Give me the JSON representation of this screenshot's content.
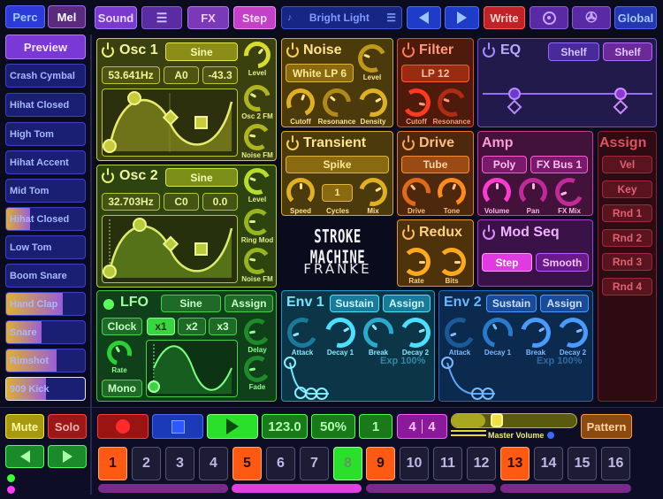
{
  "top": {
    "perc": "Perc",
    "mel": "Mel",
    "sound": "Sound",
    "fx": "FX",
    "step": "Step",
    "preset": "Bright Light",
    "write": "Write",
    "global": "Global"
  },
  "sidebar": {
    "preview": "Preview",
    "items": [
      {
        "label": "Crash Cymbal",
        "level": 0
      },
      {
        "label": "Hihat Closed",
        "level": 0
      },
      {
        "label": "High Tom",
        "level": 0
      },
      {
        "label": "Hihat Accent",
        "level": 0
      },
      {
        "label": "Mid Tom",
        "level": 0
      },
      {
        "label": "Hihat Closed",
        "level": 0.3
      },
      {
        "label": "Low Tom",
        "level": 0
      },
      {
        "label": "Boom Snare",
        "level": 0
      },
      {
        "label": "Hand Clap",
        "level": 0.72
      },
      {
        "label": "Snare",
        "level": 0.45
      },
      {
        "label": "Rimshot",
        "level": 0.64
      },
      {
        "label": "909 Kick",
        "level": 0.5
      }
    ]
  },
  "osc1": {
    "title": "Osc 1",
    "wave": "Sine",
    "freq": "53.641Hz",
    "note": "A0",
    "cents": "-43.3",
    "k1": "Level",
    "k2": "Osc 2 FM",
    "k3": "Noise FM"
  },
  "osc2": {
    "title": "Osc 2",
    "wave": "Sine",
    "freq": "32.703Hz",
    "note": "C0",
    "cents": "0.0",
    "k1": "Level",
    "k2": "Ring Mod",
    "k3": "Noise FM"
  },
  "lfo": {
    "title": "LFO",
    "wave": "Sine",
    "assign": "Assign",
    "clock": "Clock",
    "x1": "x1",
    "x2": "x2",
    "x3": "x3",
    "rate": "Rate",
    "mono": "Mono",
    "delay": "Delay",
    "fade": "Fade"
  },
  "noise": {
    "title": "Noise",
    "type": "White LP 6",
    "level": "Level",
    "cutoff": "Cutoff",
    "resonance": "Resonance",
    "density": "Density"
  },
  "transient": {
    "title": "Transient",
    "type": "Spike",
    "speed": "Speed",
    "cycles_value": "1",
    "cycles": "Cycles",
    "mix": "Mix"
  },
  "filter": {
    "title": "Filter",
    "type": "LP 12",
    "cutoff": "Cutoff",
    "resonance": "Resonance"
  },
  "drive": {
    "title": "Drive",
    "type": "Tube",
    "drive": "Drive",
    "tone": "Tone"
  },
  "redux": {
    "title": "Redux",
    "rate": "Rate",
    "bits": "Bits"
  },
  "eq": {
    "title": "EQ",
    "shelf1": "Shelf",
    "shelf2": "Shelf"
  },
  "amp": {
    "title": "Amp",
    "poly": "Poly",
    "bus": "FX Bus 1",
    "volume": "Volume",
    "pan": "Pan",
    "fxmix": "FX Mix"
  },
  "modseq": {
    "title": "Mod Seq",
    "step": "Step",
    "smooth": "Smooth"
  },
  "assign": {
    "title": "Assign",
    "items": [
      "Vel",
      "Key",
      "Rnd 1",
      "Rnd 2",
      "Rnd 3",
      "Rnd 4"
    ]
  },
  "logo": {
    "line1": "STROKE MACHINE",
    "line2": "FRANKE"
  },
  "env1": {
    "title": "Env 1",
    "sustain": "Sustain",
    "assign": "Assign",
    "attack": "Attack",
    "decay1": "Decay 1",
    "break": "Break",
    "decay2": "Decay 2",
    "exp": "Exp 100%"
  },
  "env2": {
    "title": "Env 2",
    "sustain": "Sustain",
    "assign": "Assign",
    "attack": "Attack",
    "decay1": "Decay 1",
    "break": "Break",
    "decay2": "Decay 2",
    "exp": "Exp 100%"
  },
  "transport": {
    "mute": "Mute",
    "solo": "Solo",
    "tempo": "123.0",
    "swing": "50%",
    "one": "1",
    "sig_num": "4",
    "sig_den": "4",
    "master": "Master Volume",
    "master_level": 0.2,
    "pattern": "Pattern"
  },
  "steps": [
    "1",
    "2",
    "3",
    "4",
    "5",
    "6",
    "7",
    "8",
    "9",
    "10",
    "11",
    "12",
    "13",
    "14",
    "15",
    "16"
  ],
  "step_states": [
    "on",
    "off",
    "off",
    "off",
    "on",
    "off",
    "off",
    "play",
    "on",
    "off",
    "off",
    "off",
    "on",
    "off",
    "off",
    "off"
  ]
}
